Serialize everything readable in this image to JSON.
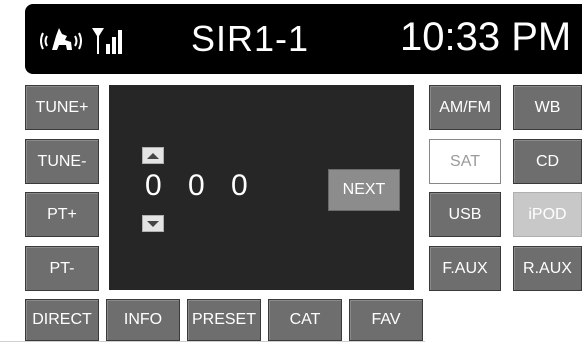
{
  "status_bar": {
    "channel": "SIR1-1",
    "clock": "10:33 PM"
  },
  "left_buttons": [
    "TUNE+",
    "TUNE-",
    "PT+",
    "PT-"
  ],
  "display": {
    "digits": [
      "0",
      "0",
      "0"
    ],
    "next_label": "NEXT"
  },
  "source_buttons": {
    "amfm": "AM/FM",
    "wb": "WB",
    "sat": "SAT",
    "cd": "CD",
    "usb": "USB",
    "ipod": "iPOD",
    "faux": "F.AUX",
    "raux": "R.AUX"
  },
  "bottom_buttons": [
    "DIRECT",
    "INFO",
    "PRESET",
    "CAT",
    "FAV"
  ],
  "colors": {
    "status_bg": "#000000",
    "button_bg": "#6e6e6e",
    "display_bg": "#262626",
    "selected_source_bg": "#ffffff",
    "disabled_source_bg": "#c8c8c8"
  }
}
